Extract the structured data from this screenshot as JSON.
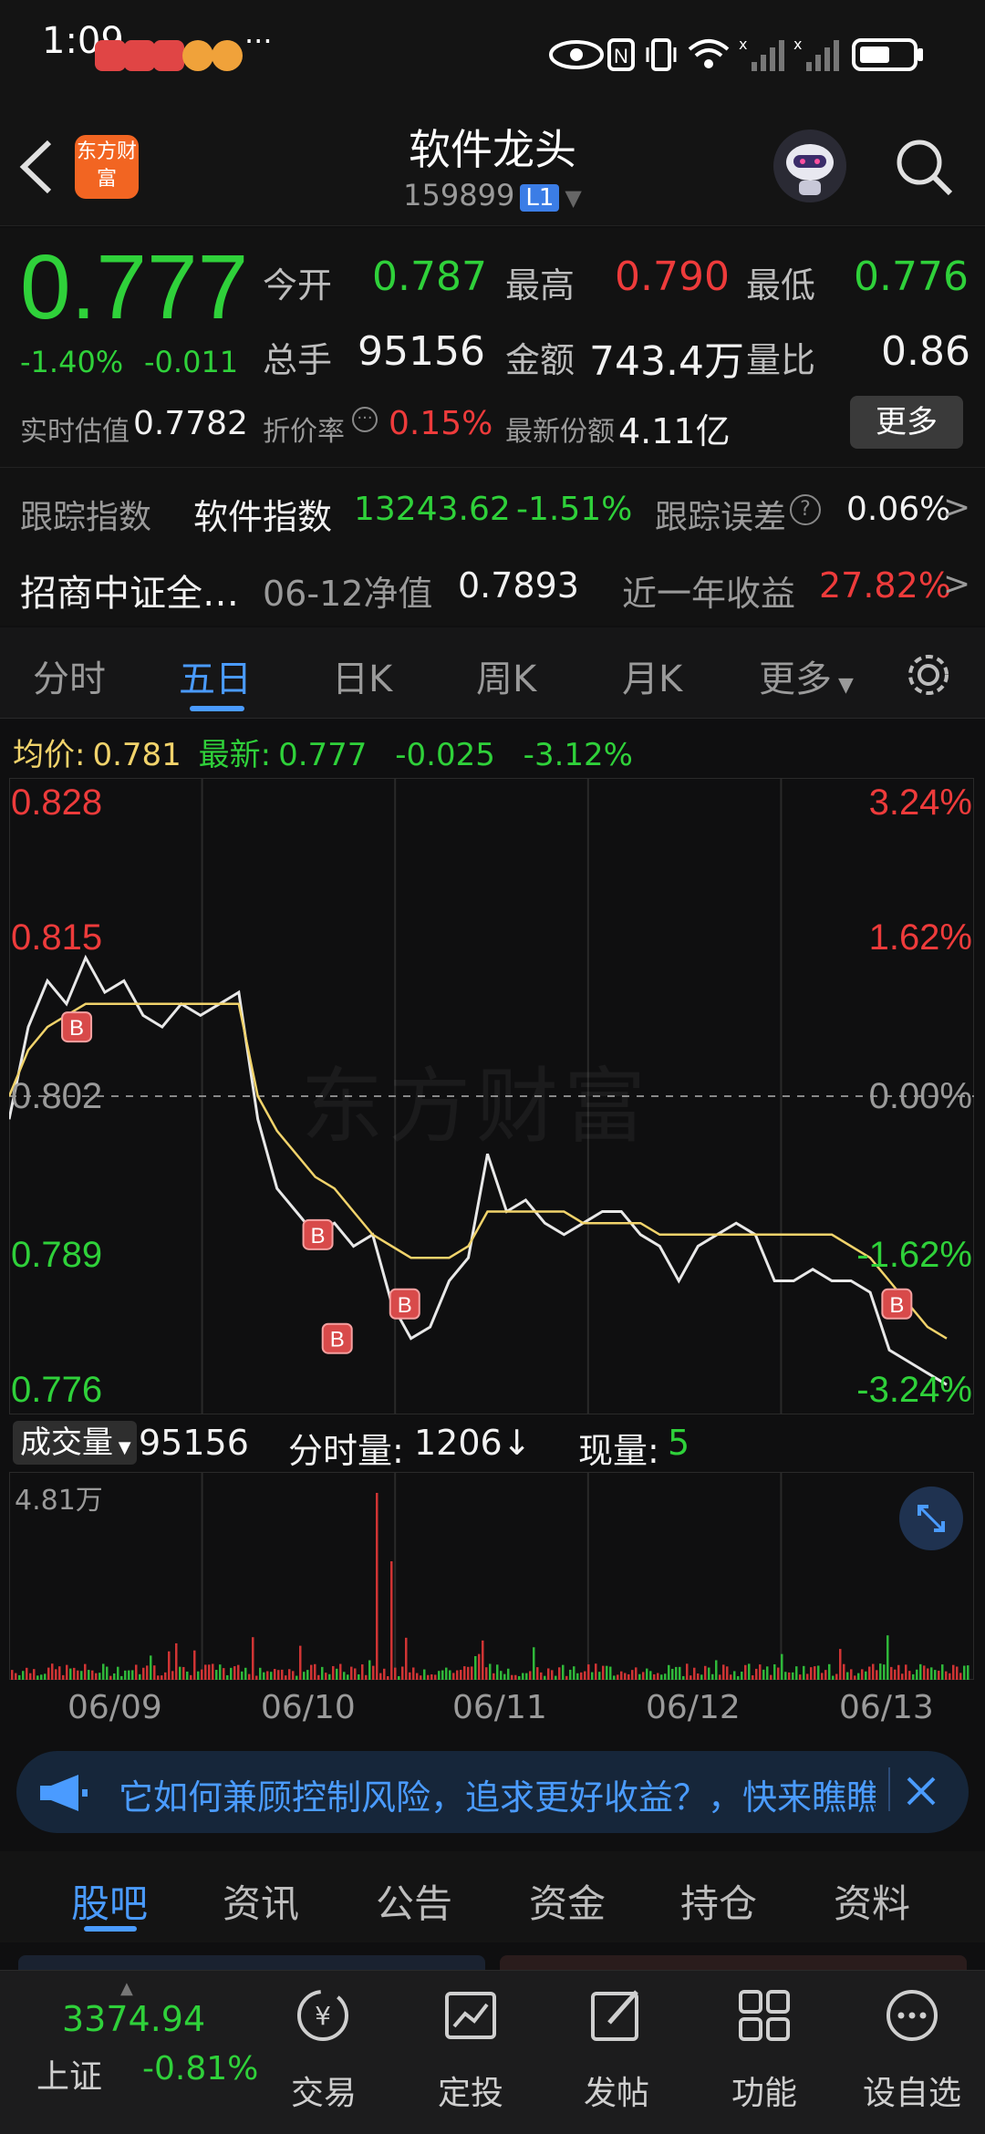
{
  "status_bar": {
    "time": "1:09",
    "extra": "···"
  },
  "header": {
    "title": "软件龙头",
    "code": "159899",
    "level": "L1",
    "logo_text": "东方财富"
  },
  "quote": {
    "price": "0.777",
    "change_pct": "-1.40%",
    "change": "-0.011",
    "open_label": "今开",
    "open": "0.787",
    "high_label": "最高",
    "high": "0.790",
    "low_label": "最低",
    "low": "0.776",
    "volume_label": "总手",
    "volume": "95156",
    "amount_label": "金额",
    "amount": "743.4万",
    "ratio_label": "量比",
    "ratio": "0.86",
    "iopv_label": "实时估值",
    "iopv": "0.7782",
    "discount_label": "折价率",
    "discount": "0.15%",
    "shares_label": "最新份额",
    "shares": "4.11亿",
    "more_button": "更多"
  },
  "tracking": {
    "label": "跟踪指数",
    "index_name": "软件指数",
    "index_value": "13243.62",
    "index_change": "-1.51%",
    "error_label": "跟踪误差",
    "error_value": "0.06%",
    "arrow": ">"
  },
  "fund": {
    "name": "招商中证全…",
    "nav_label": "06-12净值",
    "nav": "0.7893",
    "year_label": "近一年收益",
    "year_value": "27.82%",
    "arrow": ">"
  },
  "chart_tabs": [
    "分时",
    "五日",
    "日K",
    "周K",
    "月K",
    "更多"
  ],
  "active_chart_tab": "五日",
  "chart_info": {
    "avg_label": "均价:",
    "avg": "0.781",
    "latest_label": "最新:",
    "latest": "0.777",
    "chg": "-0.025",
    "chg_pct": "-3.12%"
  },
  "chart_data": {
    "type": "line",
    "ylim": [
      0.776,
      0.828
    ],
    "y_ticks_left": [
      "0.828",
      "0.815",
      "0.802",
      "0.789",
      "0.776"
    ],
    "y_ticks_right": [
      "3.24%",
      "1.62%",
      "0.00%",
      "-1.62%",
      "-3.24%"
    ],
    "x_labels": [
      "06/09",
      "06/10",
      "06/11",
      "06/12",
      "06/13"
    ],
    "watermark": "东方财富",
    "series": [
      {
        "values": [
          0.8,
          0.808,
          0.812,
          0.81,
          0.814,
          0.811,
          0.812,
          0.809,
          0.808,
          0.81,
          0.809,
          0.81,
          0.811,
          0.8,
          0.794,
          0.792,
          0.79,
          0.791,
          0.789,
          0.79,
          0.784,
          0.781,
          0.782,
          0.786,
          0.788,
          0.797,
          0.792,
          0.793,
          0.791,
          0.79,
          0.791,
          0.792,
          0.792,
          0.79,
          0.789,
          0.786,
          0.789,
          0.79,
          0.791,
          0.79,
          0.786,
          0.786,
          0.787,
          0.786,
          0.786,
          0.785,
          0.78,
          0.779,
          0.778,
          0.777
        ]
      },
      {
        "values": [
          0.802,
          0.806,
          0.808,
          0.809,
          0.81,
          0.81,
          0.81,
          0.81,
          0.81,
          0.81,
          0.81,
          0.81,
          0.81,
          0.802,
          0.799,
          0.797,
          0.795,
          0.794,
          0.792,
          0.79,
          0.789,
          0.788,
          0.788,
          0.788,
          0.789,
          0.792,
          0.792,
          0.792,
          0.792,
          0.792,
          0.791,
          0.791,
          0.791,
          0.791,
          0.79,
          0.79,
          0.79,
          0.79,
          0.79,
          0.79,
          0.79,
          0.79,
          0.79,
          0.79,
          0.789,
          0.788,
          0.786,
          0.784,
          0.782,
          0.781
        ]
      }
    ],
    "buy_markers": [
      "B",
      "B",
      "B",
      "B",
      "B"
    ]
  },
  "volume": {
    "label": "成交量",
    "total": "95156",
    "tick_label": "分时量:",
    "tick": "1206↓",
    "now_label": "现量:",
    "now": "5",
    "max": "4.81万"
  },
  "banner": {
    "text": "它如何兼顾控制风险，追求更好收益？，快来瞧瞧"
  },
  "sub_tabs": [
    "股吧",
    "资讯",
    "公告",
    "资金",
    "持仓",
    "资料"
  ],
  "active_sub_tab": "股吧",
  "bottom_nav": {
    "index_value": "3374.94",
    "index_name": "上证",
    "index_change": "-0.81%",
    "items": [
      "交易",
      "定投",
      "发帖",
      "功能",
      "设自选"
    ]
  },
  "colors": {
    "up": "#ee3b3b",
    "down": "#2fd13a",
    "accent": "#4a9bff",
    "avg_line": "#f1d36b"
  }
}
